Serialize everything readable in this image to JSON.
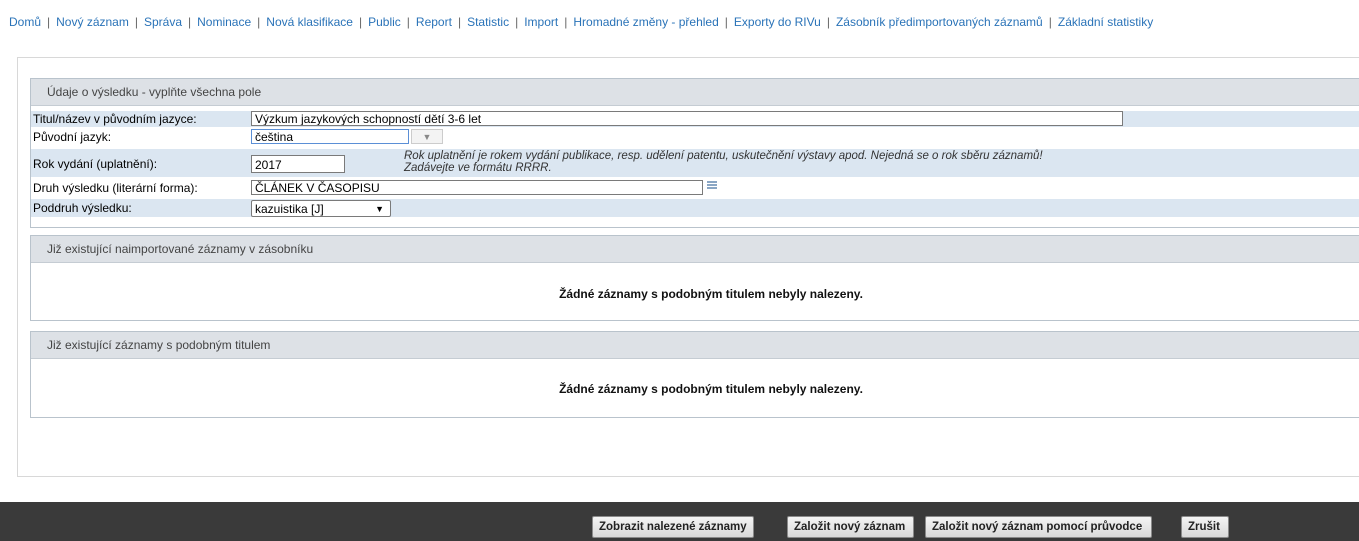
{
  "nav": {
    "items": [
      "Domů",
      "Nový záznam",
      "Správa",
      "Nominace",
      "Nová klasifikace",
      "Public",
      "Report",
      "Statistic",
      "Import",
      "Hromadné změny - přehled",
      "Exporty do RIVu",
      "Zásobník předimportovaných záznamů",
      "Základní statistiky"
    ],
    "separator": "|"
  },
  "form": {
    "header": "Údaje o výsledku - vyplňte všechna pole",
    "title_label": "Titul/název v původním jazyce:",
    "title_value": "Výzkum jazykových schopností dětí 3-6 let",
    "lang_label": "Původní jazyk:",
    "lang_value": "čeština",
    "year_label": "Rok vydání (uplatnění):",
    "year_value": "2017",
    "year_note_1": "Rok uplatnění je rokem vydání publikace, resp. udělení patentu, uskutečnění výstavy apod. Nejedná se o rok sběru záznamů!",
    "year_note_2": "Zadávejte ve formátu RRRR.",
    "kind_label": "Druh výsledku (literární forma):",
    "kind_value": "ČLÁNEK V ČASOPISU",
    "sub_label": "Poddruh výsledku:",
    "sub_value": "kazuistika [J]"
  },
  "stack": {
    "header": "Již existující naimportované záznamy v zásobníku",
    "empty": "Žádné záznamy s podobným titulem nebyly nalezeny."
  },
  "similar": {
    "header": "Již existující záznamy s podobným titulem",
    "empty": "Žádné záznamy s podobným titulem nebyly nalezeny."
  },
  "footer": {
    "show_found": "Zobrazit nalezené záznamy",
    "create_new": "Založit nový záznam",
    "create_wizard": "Založit nový záznam pomocí průvodce",
    "cancel": "Zrušit"
  },
  "colors": {
    "link": "#2a73b8",
    "section_header_bg": "#dde1e6",
    "alt_row_bg": "#dbe6f1",
    "footer_bg": "#3a3a3a"
  }
}
